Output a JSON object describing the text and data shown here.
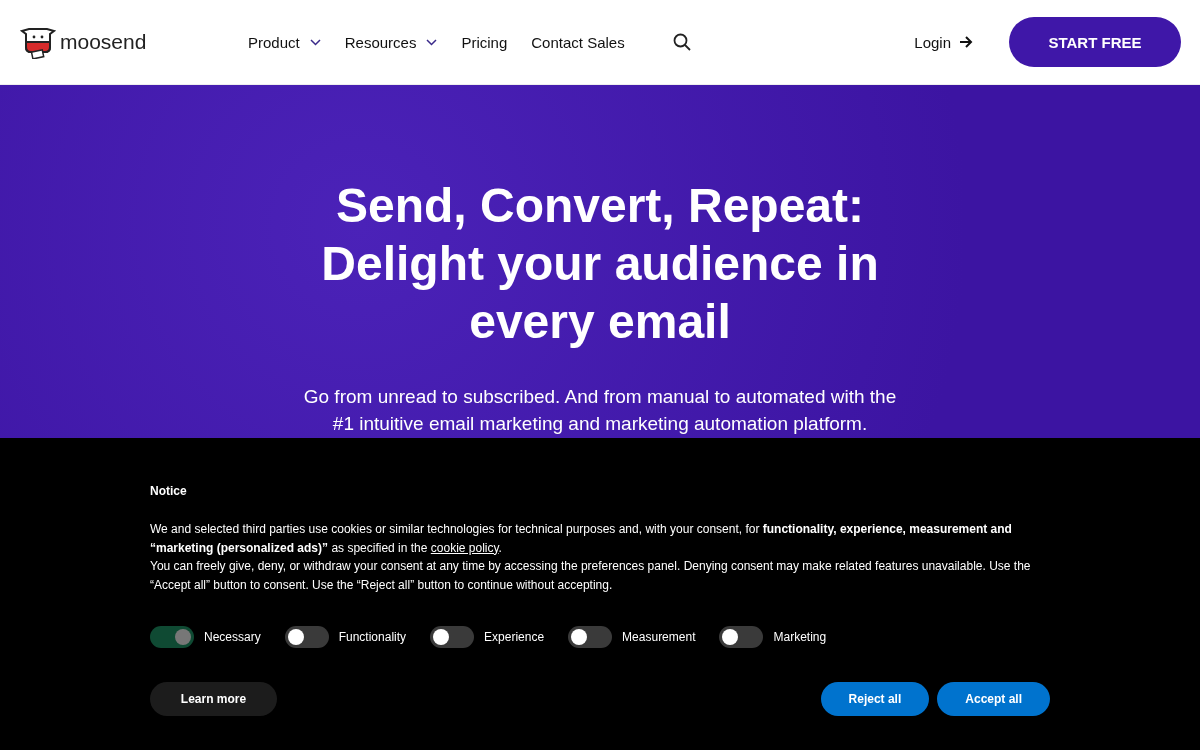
{
  "header": {
    "logo": "moosend",
    "nav": [
      {
        "label": "Product",
        "dropdown": true
      },
      {
        "label": "Resources",
        "dropdown": true
      },
      {
        "label": "Pricing",
        "dropdown": false
      },
      {
        "label": "Contact Sales",
        "dropdown": false
      }
    ],
    "login": "Login",
    "cta": "START FREE"
  },
  "hero": {
    "title_lines": [
      "Send, Convert, Repeat:",
      "Delight your audience in",
      "every email"
    ],
    "subtitle_lines": [
      "Go from unread to subscribed. And from manual to automated with the",
      "#1 intuitive email marketing and marketing automation platform."
    ]
  },
  "cookie_notice": {
    "title": "Notice",
    "intro": "We and selected third parties use cookies or similar technologies for technical purposes and, with your consent, for **functionality, experience, measurement and “marketing (personalized ads)”** as specified in the ",
    "link": "cookie policy",
    "intro_end": ".",
    "details": "You can freely give, deny, or withdraw your consent at any time by accessing the preferences panel. Denying consent may make related features unavailable. Use the “Accept all” button to consent. Use the “Reject all” button to continue without accepting.",
    "toggles": [
      {
        "label": "Necessary",
        "on": true,
        "disabled": true
      },
      {
        "label": "Functionality",
        "on": false,
        "disabled": false
      },
      {
        "label": "Experience",
        "on": false,
        "disabled": false
      },
      {
        "label": "Measurement",
        "on": false,
        "disabled": false
      },
      {
        "label": "Marketing",
        "on": false,
        "disabled": false
      }
    ],
    "learn_more": "Learn more",
    "reject": "Reject all",
    "accept": "Accept all"
  }
}
